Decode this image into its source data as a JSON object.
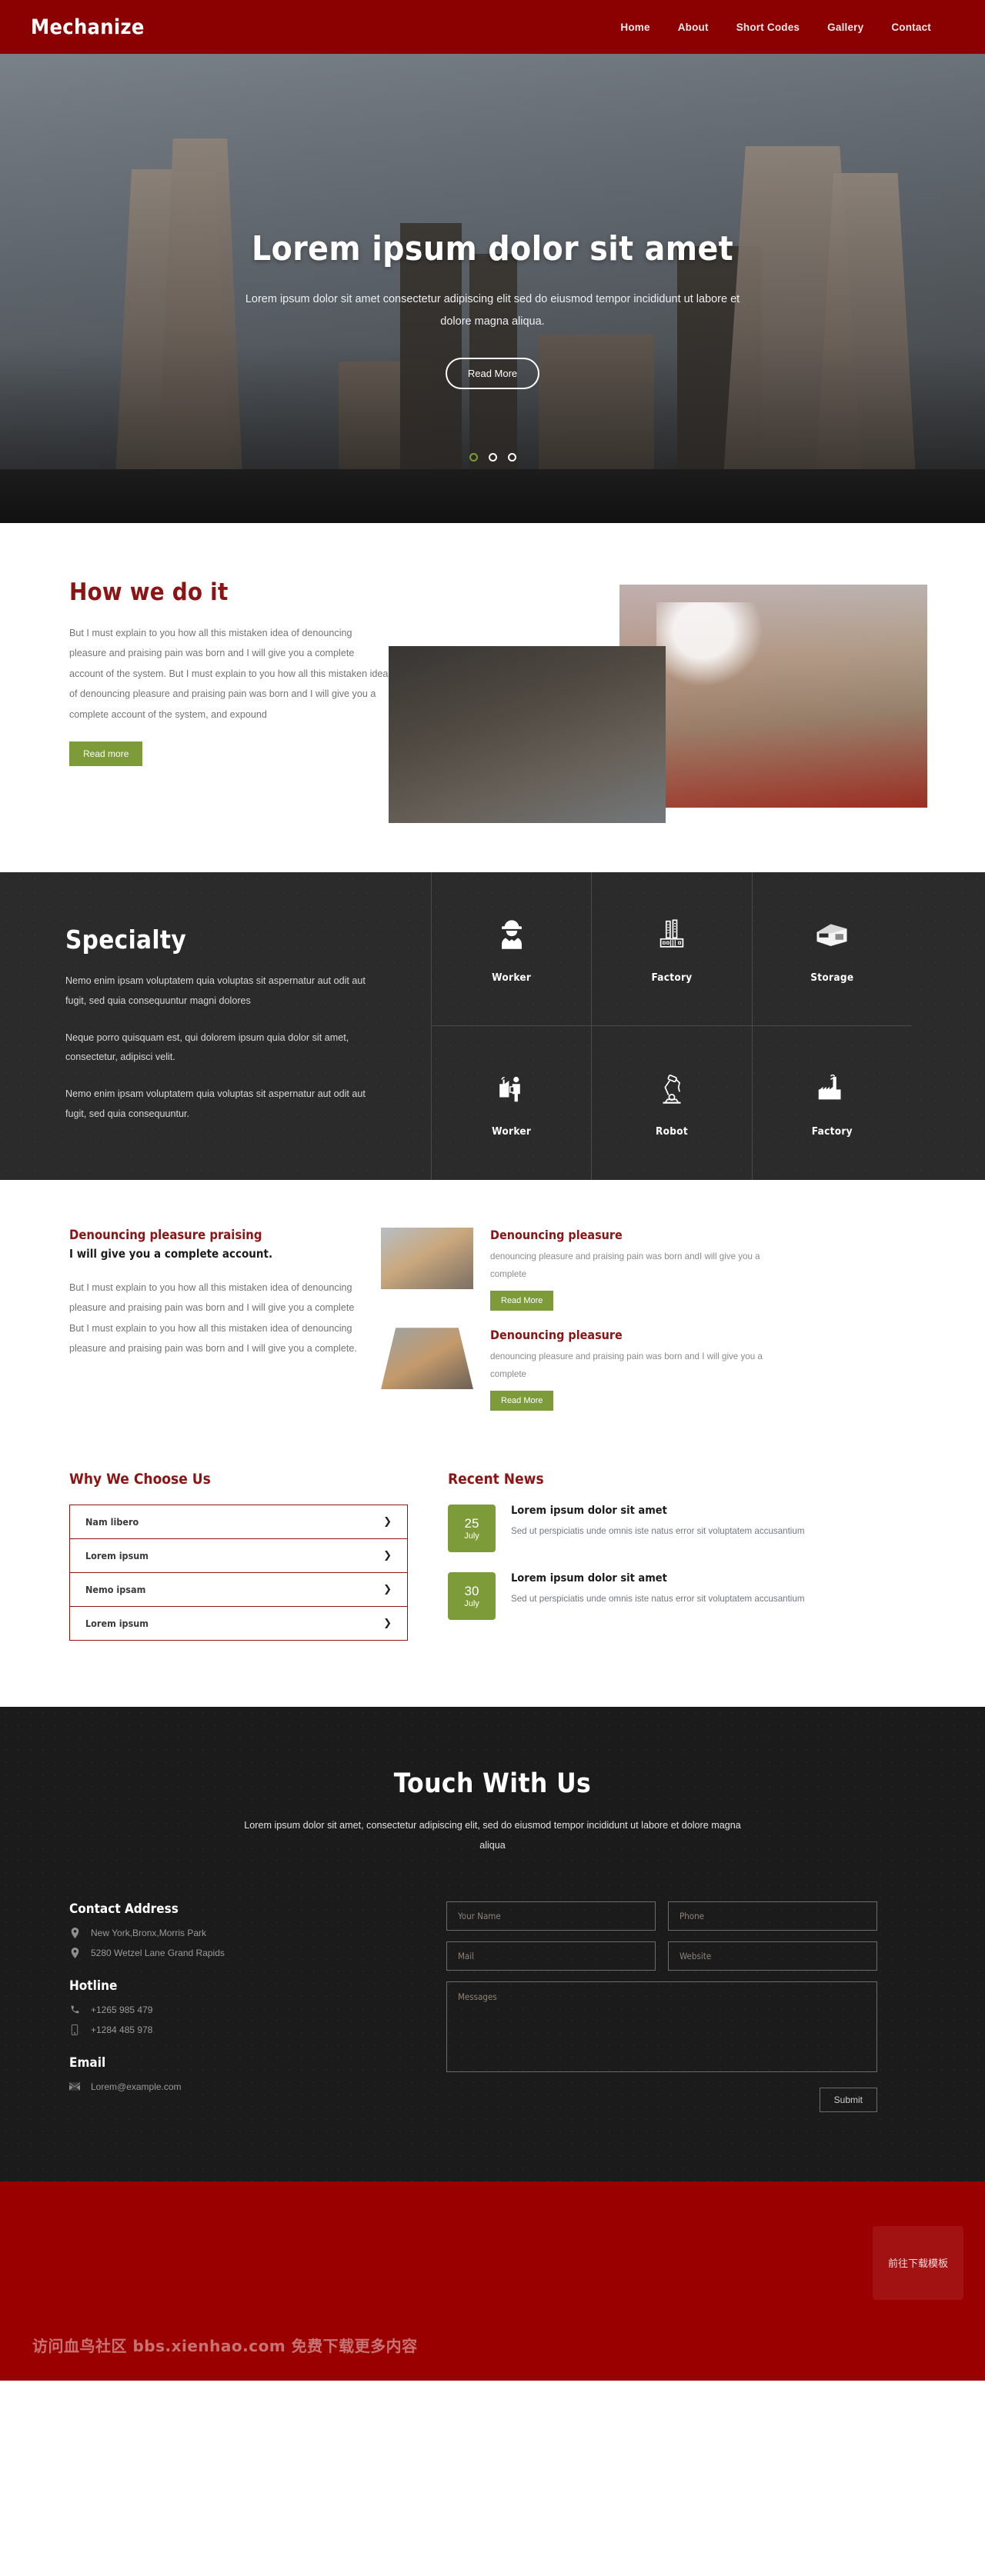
{
  "header": {
    "brand": "Mechanize",
    "nav": [
      {
        "label": "Home"
      },
      {
        "label": "About"
      },
      {
        "label": "Short Codes"
      },
      {
        "label": "Gallery"
      },
      {
        "label": "Contact"
      }
    ]
  },
  "hero": {
    "title": "Lorem ipsum dolor sit amet",
    "subtitle": "Lorem ipsum dolor sit amet consectetur adipiscing elit sed do eiusmod tempor incididunt ut labore et dolore magna aliqua.",
    "button": "Read More",
    "active_dot": 1,
    "dot_count": 3,
    "active_dot_color": "#7d9b38"
  },
  "howwe": {
    "title": "How we do it",
    "text": "But I must explain to you how all this mistaken idea of denouncing pleasure and praising pain was born and I will give you a complete account of the system. But I must explain to you how all this mistaken idea of denouncing pleasure and praising pain was born and I will give you a complete account of the system, and expound",
    "button": "Read more"
  },
  "specialty": {
    "title": "Specialty",
    "paragraphs": [
      "Nemo enim ipsam voluptatem quia voluptas sit aspernatur aut odit aut fugit, sed quia consequuntur magni dolores",
      "Neque porro quisquam est, qui dolorem ipsum quia dolor sit amet, consectetur, adipisci velit.",
      "Nemo enim ipsam voluptatem quia voluptas sit aspernatur aut odit aut fugit, sed quia consequuntur."
    ],
    "cells": [
      {
        "label": "Worker",
        "icon": "worker-helmet-icon"
      },
      {
        "label": "Factory",
        "icon": "factory-chimneys-icon"
      },
      {
        "label": "Storage",
        "icon": "warehouse-icon"
      },
      {
        "label": "Worker",
        "icon": "worker-at-factory-icon"
      },
      {
        "label": "Robot",
        "icon": "robot-arm-icon"
      },
      {
        "label": "Factory",
        "icon": "factory-smoke-icon"
      }
    ]
  },
  "denounce": {
    "heading": "Denouncing pleasure praising",
    "subheading": "I will give you a complete account.",
    "text": "But I must explain to you how all this mistaken idea of denouncing pleasure and praising pain was born and I will give you a complete But I must explain to you how all this mistaken idea of denouncing pleasure and praising pain was born and I will give you a complete.",
    "items": [
      {
        "title": "Denouncing pleasure",
        "text": "denouncing pleasure and praising pain was born andI will give you a complete",
        "button": "Read More"
      },
      {
        "title": "Denouncing pleasure",
        "text": "denouncing pleasure and praising pain was born and I will give you a complete",
        "button": "Read More"
      }
    ]
  },
  "why": {
    "title": "Why We Choose Us",
    "items": [
      {
        "label": "Nam libero",
        "chevron": "chevron-down-icon"
      },
      {
        "label": "Lorem ipsum",
        "chevron": "chevron-down-icon"
      },
      {
        "label": "Nemo ipsam",
        "chevron": "chevron-down-icon"
      },
      {
        "label": "Lorem ipsum",
        "chevron": "chevron-down-icon"
      }
    ]
  },
  "news": {
    "title": "Recent News",
    "items": [
      {
        "day": "25",
        "month": "July",
        "title": "Lorem ipsum dolor sit amet",
        "text": "Sed ut perspiciatis unde omnis iste natus error sit voluptatem accusantium"
      },
      {
        "day": "30",
        "month": "July",
        "title": "Lorem ipsum dolor sit amet",
        "text": "Sed ut perspiciatis unde omnis iste natus error sit voluptatem accusantium"
      }
    ]
  },
  "touch": {
    "title": "Touch With Us",
    "subtitle": "Lorem ipsum dolor sit amet, consectetur adipiscing elit, sed do eiusmod tempor incididunt ut labore et dolore magna aliqua",
    "contact": {
      "address_head": "Contact Address",
      "address_lines": [
        {
          "icon": "map-pin-icon",
          "text": "New York,Bronx,Morris Park"
        },
        {
          "icon": "map-pin-icon",
          "text": "5280 Wetzel Lane Grand Rapids"
        }
      ],
      "hotline_head": "Hotline",
      "hotline_lines": [
        {
          "icon": "phone-icon",
          "text": "+1265 985 479"
        },
        {
          "icon": "mobile-icon",
          "text": "+1284 485 978"
        }
      ],
      "email_head": "Email",
      "email_lines": [
        {
          "icon": "envelope-icon",
          "text": "Lorem@example.com"
        }
      ]
    },
    "form": {
      "name_placeholder": "Your Name",
      "phone_placeholder": "Phone",
      "mail_placeholder": "Mail",
      "website_placeholder": "Website",
      "messages_placeholder": "Messages",
      "name_value": "",
      "phone_value": "",
      "mail_value": "",
      "website_value": "",
      "messages_value": "",
      "submit_label": "Submit"
    }
  },
  "watermark": {
    "text": "访问血鸟社区 bbs.xienhao.com 免费下载更多内容",
    "badge": "前往下载模板"
  },
  "colors": {
    "brand_red": "#8b0000",
    "accent_red": "#8b1414",
    "accent_green": "#7d9b38",
    "dark": "#2b2b2b",
    "footer_dark": "#1b1b1b",
    "bottom_bar": "#9b0000"
  }
}
